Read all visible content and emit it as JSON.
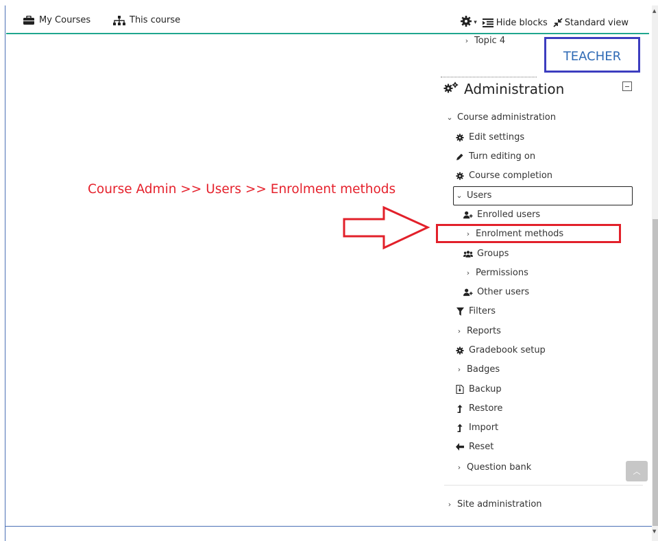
{
  "navbar": {
    "my_courses": "My Courses",
    "this_course": "This course",
    "hide_blocks": "Hide blocks",
    "standard_view": "Standard view"
  },
  "nav_block": {
    "topic4": "Topic 4"
  },
  "badge": {
    "teacher": "TEACHER"
  },
  "admin": {
    "title": "Administration",
    "course_admin": "Course administration",
    "items": {
      "edit_settings": "Edit settings",
      "turn_editing_on": "Turn editing on",
      "course_completion": "Course completion",
      "users": "Users",
      "enrolled_users": "Enrolled users",
      "enrolment_methods": "Enrolment methods",
      "groups": "Groups",
      "permissions": "Permissions",
      "other_users": "Other users",
      "filters": "Filters",
      "reports": "Reports",
      "gradebook_setup": "Gradebook setup",
      "badges": "Badges",
      "backup": "Backup",
      "restore": "Restore",
      "import": "Import",
      "reset": "Reset",
      "question_bank": "Question bank"
    },
    "site_admin": "Site administration"
  },
  "annotation": {
    "text": "Course Admin >> Users >> Enrolment methods"
  },
  "colors": {
    "accent_line": "#1fa68e",
    "highlight_red": "#e2202a",
    "teacher_border": "#3c3dbf",
    "teacher_text": "#2f6ab5"
  }
}
